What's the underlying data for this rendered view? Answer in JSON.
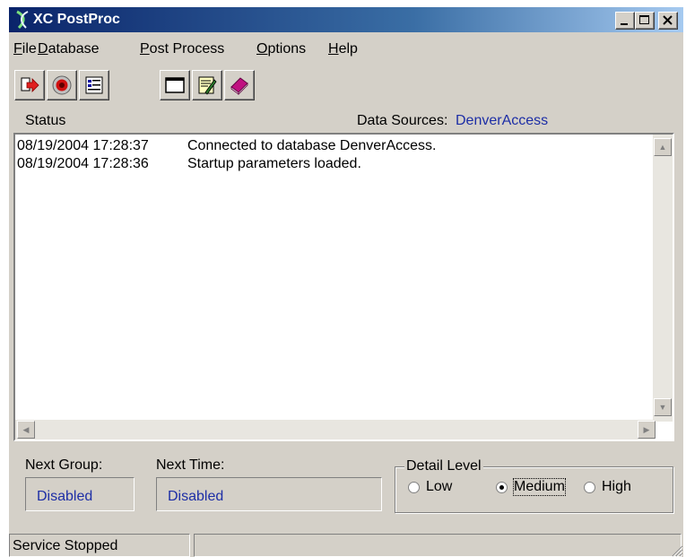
{
  "window": {
    "title": "XC PostProc"
  },
  "menu": [
    {
      "key": "F",
      "rest": "ile"
    },
    {
      "key": "D",
      "rest": "atabase"
    },
    {
      "key": "P",
      "rest": "ost Process"
    },
    {
      "key": "O",
      "rest": "ptions"
    },
    {
      "key": "H",
      "rest": "elp"
    }
  ],
  "toolbar": {
    "icons": [
      "exit-icon",
      "record-icon",
      "list-icon",
      "window-icon",
      "edit-icon",
      "book-icon"
    ]
  },
  "status_header": {
    "status_label": "Status",
    "data_sources_label": "Data Sources:",
    "data_sources_value": "DenverAccess"
  },
  "log": [
    {
      "time": "08/19/2004 17:28:37",
      "message": "Connected to database DenverAccess."
    },
    {
      "time": "08/19/2004 17:28:36",
      "message": "Startup parameters loaded."
    }
  ],
  "next_group": {
    "label": "Next Group:",
    "value": "Disabled"
  },
  "next_time": {
    "label": "Next Time:",
    "value": "Disabled"
  },
  "detail_level": {
    "title": "Detail Level",
    "options": [
      "Low",
      "Medium",
      "High"
    ],
    "selected": "Medium"
  },
  "statusbar": {
    "text": "Service Stopped"
  },
  "colors": {
    "title_gradient_start": "#0a246a",
    "value_text": "#1d2ea6",
    "face": "#d4d0c8"
  }
}
